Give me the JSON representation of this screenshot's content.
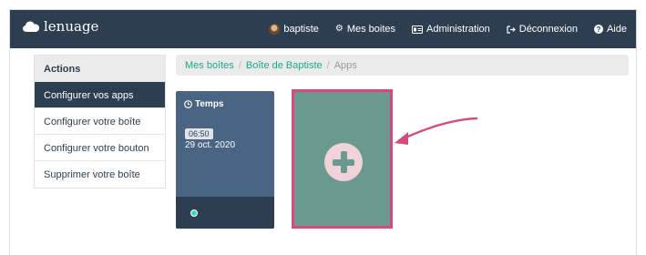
{
  "navbar": {
    "brand": "lenuage",
    "user": "baptiste",
    "links": [
      {
        "label": "Mes boites",
        "icon": "cogs-icon"
      },
      {
        "label": "Administration",
        "icon": "id-card-icon"
      },
      {
        "label": "Déconnexion",
        "icon": "sign-out-icon"
      },
      {
        "label": "Aide",
        "icon": "question-circle-icon"
      }
    ]
  },
  "sidebar": {
    "title": "Actions",
    "items": [
      {
        "label": "Configurer vos apps",
        "active": true
      },
      {
        "label": "Configurer votre boîte",
        "active": false
      },
      {
        "label": "Configurer votre bouton",
        "active": false
      },
      {
        "label": "Supprimer votre boîte",
        "active": false
      }
    ]
  },
  "breadcrumb": {
    "items": [
      "Mes boîtes",
      "Boîte de Baptiste",
      "Apps"
    ],
    "separator": "/"
  },
  "app_card": {
    "title": "Temps",
    "icon": "clock-icon",
    "time": "06:50",
    "date": "29 oct. 2020",
    "status_color": "#3ad9b8"
  },
  "add_tile": {
    "icon": "plus-circle-icon",
    "highlight_color": "#d64a7e"
  },
  "colors": {
    "navbar": "#2d3e50",
    "accent": "#1aaa8a",
    "card": "#4a6583",
    "tile": "#6a9a8f",
    "annotation": "#d64a7e"
  }
}
